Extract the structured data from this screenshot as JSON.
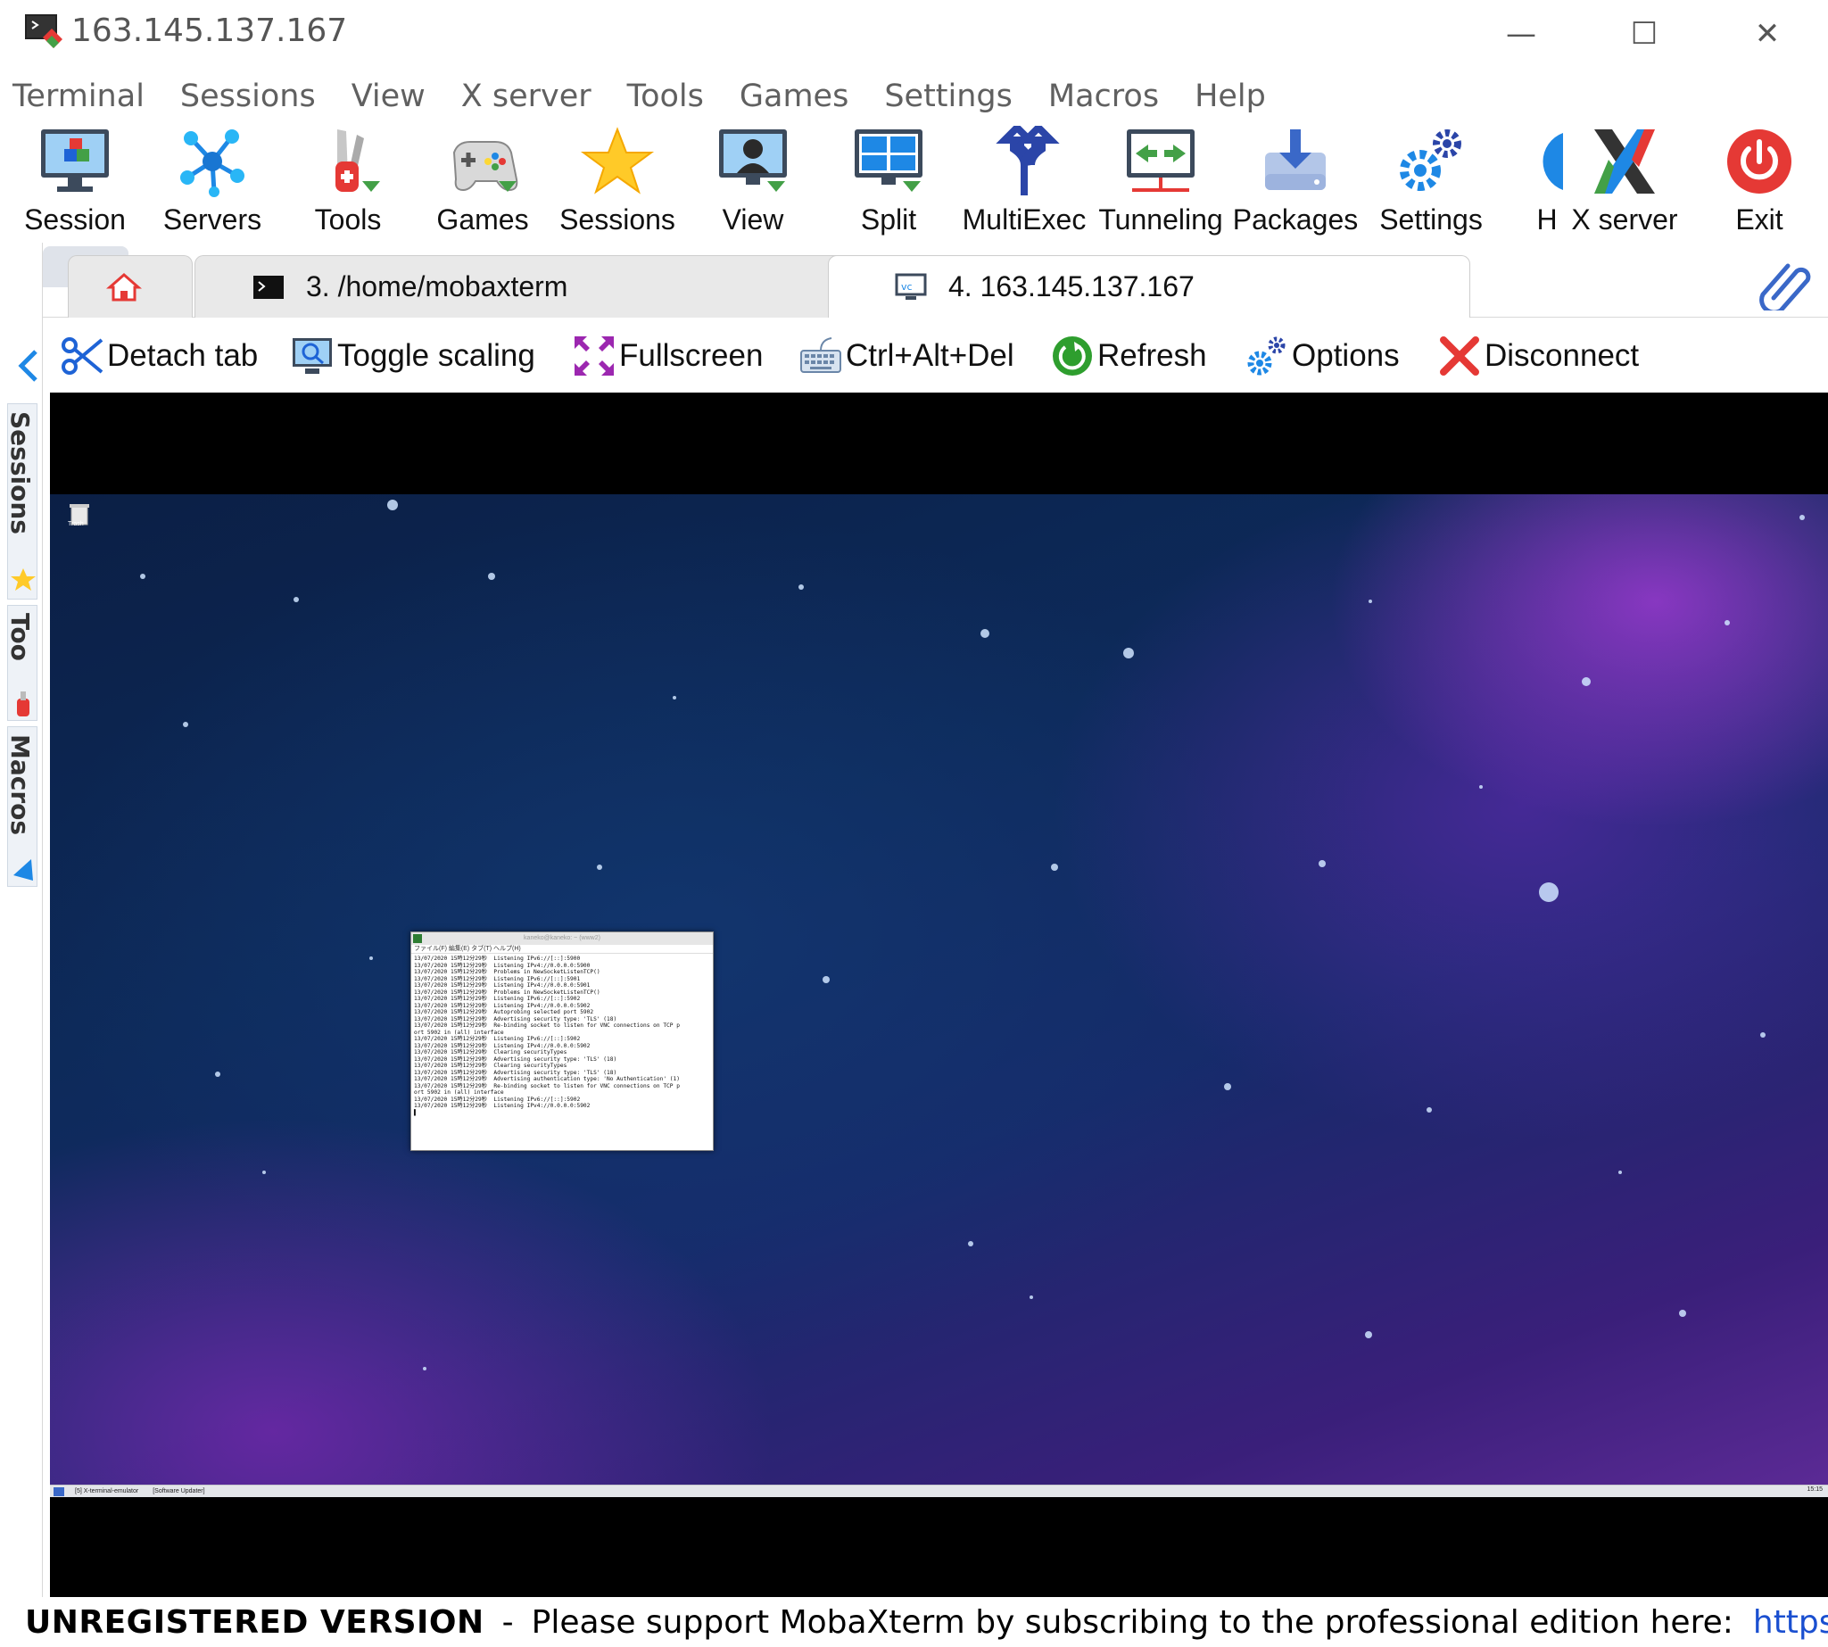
{
  "window": {
    "title": "163.145.137.167",
    "minimize": "—",
    "maximize": "☐",
    "close": "✕"
  },
  "menu": [
    "Terminal",
    "Sessions",
    "View",
    "X server",
    "Tools",
    "Games",
    "Settings",
    "Macros",
    "Help"
  ],
  "toolbar": {
    "session": "Session",
    "servers": "Servers",
    "tools": "Tools",
    "games": "Games",
    "sessions": "Sessions",
    "view": "View",
    "split": "Split",
    "multiexec": "MultiExec",
    "tunneling": "Tunneling",
    "packages": "Packages",
    "settings": "Settings",
    "help": "H",
    "xserver": "X server",
    "exit": "Exit"
  },
  "sidebar": {
    "sessions": "Sessions",
    "tools": "Too",
    "macros": "Macros"
  },
  "tabs": {
    "terminal": "3. /home/mobaxterm",
    "vnc": "4. 163.145.137.167",
    "add": "+"
  },
  "actions": {
    "detach": "Detach tab",
    "scaling": "Toggle scaling",
    "fullscreen": "Fullscreen",
    "ctrlaltdel": "Ctrl+Alt+Del",
    "refresh": "Refresh",
    "options": "Options",
    "disconnect": "Disconnect"
  },
  "remote": {
    "trash_label": "Trash",
    "terminal_title": "kaneko@kaneko: ~ (www2)",
    "terminal_menu": "ファイル(F)  編集(E)  タブ(T)  ヘルプ(H)",
    "terminal_lines": [
      "13/07/2020 15時12分29秒  Listening IPv6://[::]:5900",
      "13/07/2020 15時12分29秒  Listening IPv4://0.0.0.0:5900",
      "13/07/2020 15時12分29秒  Problems in NewSocketListenTCP()",
      "13/07/2020 15時12分29秒  Listening IPv6://[::]:5901",
      "13/07/2020 15時12分29秒  Listening IPv4://0.0.0.0:5901",
      "13/07/2020 15時12分29秒  Problems in NewSocketListenTCP()",
      "13/07/2020 15時12分29秒  Listening IPv6://[::]:5902",
      "13/07/2020 15時12分29秒  Listening IPv4://0.0.0.0:5902",
      "13/07/2020 15時12分29秒  Autoprobing selected port 5902",
      "13/07/2020 15時12分29秒  Advertising security type: 'TLS' (18)",
      "13/07/2020 15時12分29秒  Re-binding socket to listen for VNC connections on TCP p",
      "ort 5902 in (all) interface",
      "13/07/2020 15時12分29秒  Listening IPv6://[::]:5902",
      "13/07/2020 15時12分29秒  Listening IPv4://0.0.0.0:5902",
      "13/07/2020 15時12分29秒  Clearing securityTypes",
      "13/07/2020 15時12分29秒  Advertising security type: 'TLS' (18)",
      "13/07/2020 15時12分29秒  Clearing securityTypes",
      "13/07/2020 15時12分29秒  Advertising security type: 'TLS' (18)",
      "13/07/2020 15時12分29秒  Advertising authentication type: 'No Authentication' (1)",
      "13/07/2020 15時12分29秒  Re-binding socket to listen for VNC connections on TCP p",
      "ort 5902 in (all) interface",
      "13/07/2020 15時12分29秒  Listening IPv6://[::]:5902",
      "13/07/2020 15時12分29秒  Listening IPv4://0.0.0.0:5902",
      "▌"
    ],
    "taskbar_item1": "[5] X-terminal-emulator",
    "taskbar_item2": "[Software Updater]",
    "tray_clock": "15:15"
  },
  "status": {
    "badge": "UNREGISTERED VERSION",
    "sep": "-",
    "message": "Please support MobaXterm by subscribing to the professional edition here:",
    "link": "https://mobaxterm"
  },
  "colors": {
    "accent_blue": "#1a4fd0",
    "exit_red": "#e53935",
    "refresh_green": "#2e9e2e"
  }
}
